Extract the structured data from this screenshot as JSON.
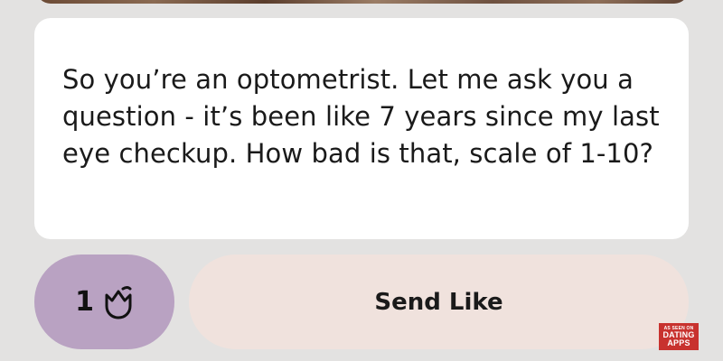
{
  "message": {
    "text": "So you’re an optometrist. Let me ask you a question - it’s been like 7 years since my last eye checkup. How bad is that, scale of 1-10?"
  },
  "rose": {
    "count": "1",
    "icon": "rose-icon"
  },
  "actions": {
    "send_like_label": "Send Like"
  },
  "watermark": {
    "line1": "AS SEEN ON",
    "line2": "DATING",
    "line3": "APPS"
  },
  "colors": {
    "background": "#e3e2e1",
    "card": "#ffffff",
    "rose_button": "#b9a2c2",
    "send_like_button": "#f0e2dd",
    "watermark": "#c8322e"
  }
}
